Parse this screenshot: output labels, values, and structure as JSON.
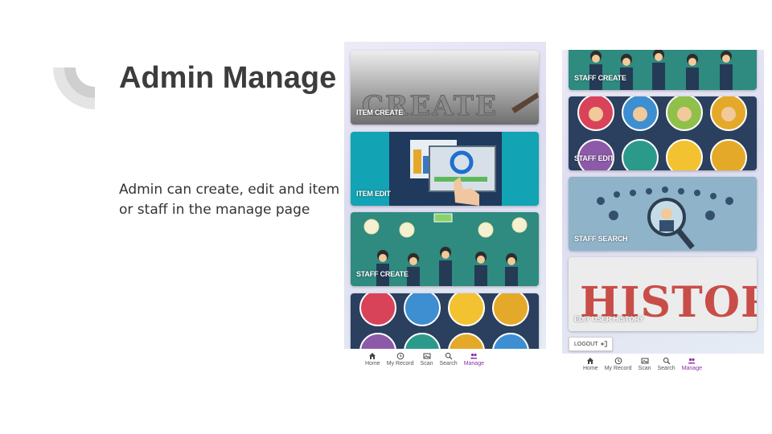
{
  "slide": {
    "title": "Admin Manage",
    "body_lines": [
      "Admin can create, edit and item",
      "or staff in the manage page"
    ]
  },
  "phone_left": {
    "cards": [
      {
        "label": "ITEM CREATE",
        "art_text": "CREATE"
      },
      {
        "label": "ITEM EDIT"
      },
      {
        "label": "STAFF CREATE"
      },
      {
        "label": ""
      }
    ]
  },
  "phone_right": {
    "cards": [
      {
        "label": "STAFF CREATE"
      },
      {
        "label": "STAFF EDIT"
      },
      {
        "label": "STAFF SEARCH"
      },
      {
        "label": "EDIT USER HISTORY",
        "art_text": "HISTORY"
      }
    ],
    "logout_label": "LOGOUT"
  },
  "bottom_nav": {
    "items": [
      {
        "label": "Home",
        "icon": "home-icon"
      },
      {
        "label": "My Record",
        "icon": "history-icon"
      },
      {
        "label": "Scan",
        "icon": "scan-icon"
      },
      {
        "label": "Search",
        "icon": "search-icon"
      },
      {
        "label": "Manage",
        "icon": "people-icon",
        "active": true
      }
    ]
  },
  "colors": {
    "title": "#3c3c3c",
    "nav_active": "#8a2fa8",
    "card_teal": "#2f8a80",
    "card_navy": "#2b3f5e"
  }
}
